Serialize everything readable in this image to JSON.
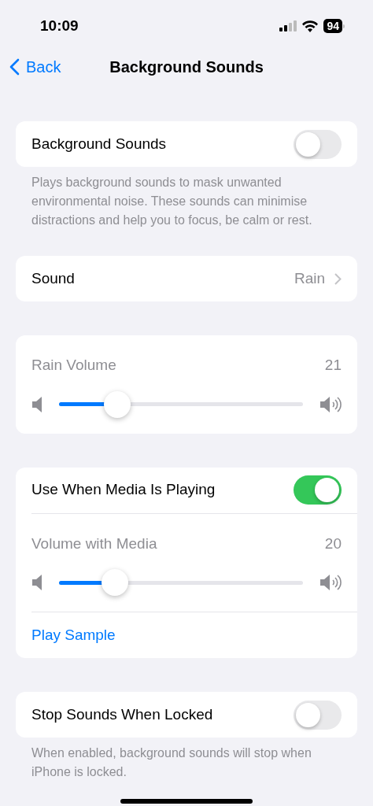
{
  "status_bar": {
    "time": "10:09",
    "battery": "94"
  },
  "nav": {
    "back": "Back",
    "title": "Background Sounds"
  },
  "sections": [
    {
      "rows": [
        {
          "kind": "toggle",
          "label": "Background Sounds",
          "on": false
        }
      ],
      "footer": "Plays background sounds to mask unwanted environmental noise. These sounds can minimise distractions and help you to focus, be calm or rest."
    },
    {
      "rows": [
        {
          "kind": "value",
          "label": "Sound",
          "value": "Rain"
        }
      ]
    },
    {
      "rows": [
        {
          "kind": "slider",
          "label": "Rain Volume",
          "reading": "21",
          "level": 0.24
        }
      ]
    },
    {
      "rows": [
        {
          "kind": "toggle",
          "label": "Use When Media Is Playing",
          "on": true
        },
        {
          "kind": "slider",
          "label": "Volume with Media",
          "reading": "20",
          "level": 0.23
        },
        {
          "kind": "link",
          "label": "Play Sample"
        }
      ]
    },
    {
      "rows": [
        {
          "kind": "toggle",
          "label": "Stop Sounds When Locked",
          "on": false
        }
      ],
      "footer": "When enabled, background sounds will stop when iPhone is locked."
    }
  ]
}
